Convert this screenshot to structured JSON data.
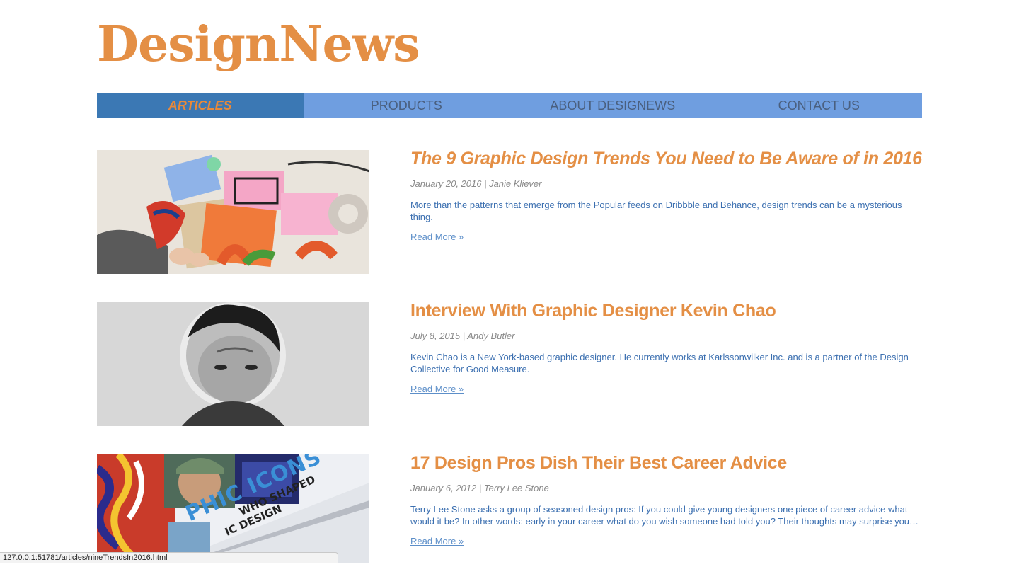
{
  "site": {
    "logo": "DesignNews"
  },
  "nav": {
    "items": [
      {
        "label": "ARTICLES",
        "active": true
      },
      {
        "label": "PRODUCTS",
        "active": false
      },
      {
        "label": "ABOUT DESIGNEWS",
        "active": false
      },
      {
        "label": "CONTACT US",
        "active": false
      }
    ]
  },
  "articles": [
    {
      "title": "The 9 Graphic Design Trends You Need to Be Aware of in 2016",
      "meta": "January 20, 2016 | Janie Kliever",
      "summary": "More than the patterns that emerge from the Popular feeds on Dribbble and Behance, design trends can be a mysterious thing.",
      "read_more": "Read More »",
      "image": "design-trends-objects-photo"
    },
    {
      "title": "Interview With Graphic Designer Kevin Chao",
      "meta": "July 8, 2015 | Andy Butler",
      "summary": "Kevin Chao is a New York-based graphic designer. He currently works at Karlssonwilker Inc. and is a partner of the Design Collective for Good Measure.",
      "read_more": "Read More »",
      "image": "kevin-chao-portrait-photo"
    },
    {
      "title": "17 Design Pros Dish Their Best Career Advice",
      "meta": "January 6, 2012 | Terry Lee Stone",
      "summary": "Terry Lee Stone asks a group of seasoned design pros: If you could give young designers one piece of career advice what would it be? In other words: early in your career what do you wish someone had told you? Their thoughts may surprise you…",
      "read_more": "Read More »",
      "image": "graphic-icons-book-photo",
      "book_cover_text": [
        "PHIC ICONS",
        "WHO SHAPED",
        "IC DESIGN"
      ]
    }
  ],
  "status_bar": {
    "url": "127.0.0.1:51781/articles/nineTrendsIn2016.html"
  },
  "colors": {
    "accent": "#e48f45",
    "nav_bg": "#6f9ee0",
    "nav_active_bg": "#3b78b4",
    "link": "#3b6fb0"
  }
}
